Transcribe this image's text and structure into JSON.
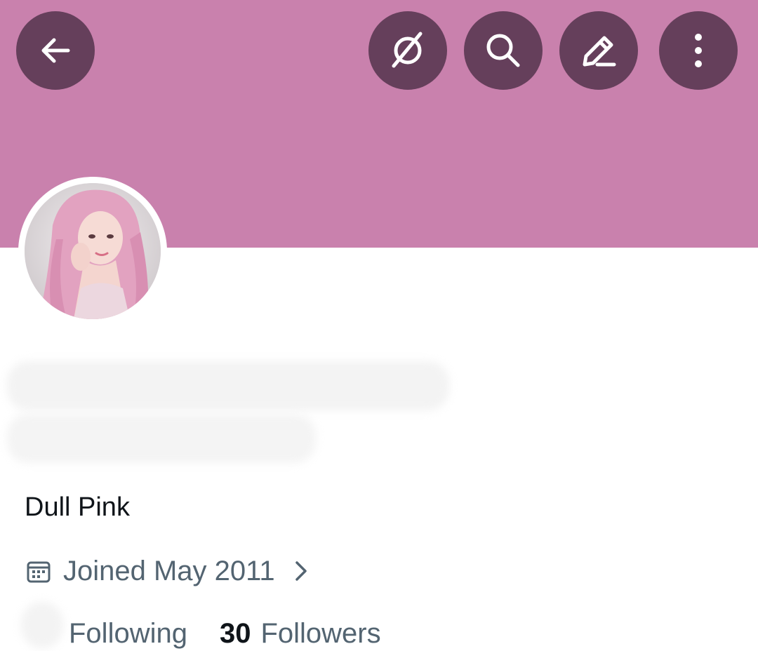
{
  "header": {
    "back_icon": "arrow-left-icon",
    "grok_icon": "grok-icon",
    "search_icon": "search-icon",
    "edit_icon": "edit-pencil-icon",
    "more_icon": "more-vertical-icon",
    "banner_color": "#c981ad",
    "button_color": "#653f5b"
  },
  "profile": {
    "bio": "Dull Pink",
    "joined": "Joined May 2011",
    "following_label": "Following",
    "followers_count": "30",
    "followers_label": "Followers"
  }
}
